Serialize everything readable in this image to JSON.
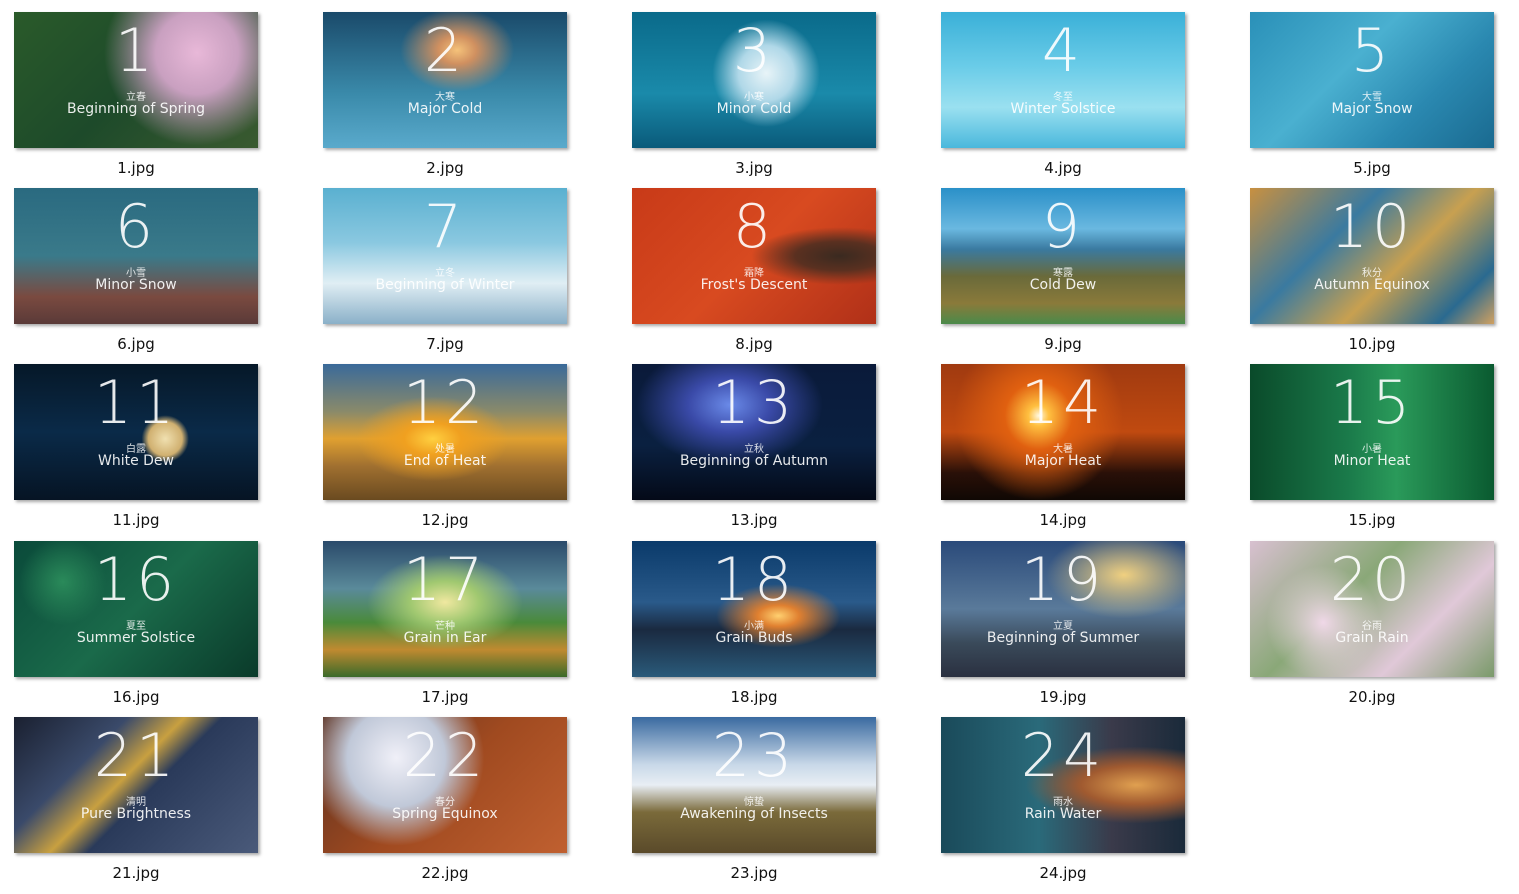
{
  "files": [
    {
      "name": "1.jpg",
      "num": "1",
      "cn": "立春",
      "en": "Beginning of Spring",
      "bg": "radial-gradient(circle at 75% 30%,#e8b8d8 0,#c9a0c0 20%,transparent 45%),linear-gradient(135deg,#2a5a2a,#1d4a2a 50%,#3a5a30)"
    },
    {
      "name": "2.jpg",
      "num": "2",
      "cn": "大寒",
      "en": "Major Cold",
      "bg": "radial-gradient(ellipse at 55% 28%,#f5c27a 0,#d09060 10%,transparent 30%),linear-gradient(180deg,#1a4a6a,#2a6a8a 30%,#3a8aaa 60%,#5aaacc)"
    },
    {
      "name": "3.jpg",
      "num": "3",
      "cn": "小寒",
      "en": "Minor Cold",
      "bg": "radial-gradient(circle at 55% 45%,#e8f4f8 0,#b0d8e8 18%,transparent 35%),linear-gradient(180deg,#0a6a8a,#1a8aaa 60%,#0a5a7a)"
    },
    {
      "name": "4.jpg",
      "num": "4",
      "cn": "冬至",
      "en": "Winter Solstice",
      "bg": "linear-gradient(180deg,#3ab0d8,#6acce8 40%,#9ae0f0 70%,#4ab8dc)"
    },
    {
      "name": "5.jpg",
      "num": "5",
      "cn": "大雪",
      "en": "Major Snow",
      "bg": "linear-gradient(135deg,#2a90b8,#4ab0d0 40%,#2a88b0 70%,#1a6a90)"
    },
    {
      "name": "6.jpg",
      "num": "6",
      "cn": "小雪",
      "en": "Minor Snow",
      "bg": "linear-gradient(180deg,#2a6a80,#3a7a8a 50%,#7a4a40 80%,#5a3a38)"
    },
    {
      "name": "7.jpg",
      "num": "7",
      "cn": "立冬",
      "en": "Beginning of Winter",
      "bg": "linear-gradient(180deg,#5ab0d0,#8ac8e0 40%,#e0eef4 70%,#8ab0c8)"
    },
    {
      "name": "8.jpg",
      "num": "8",
      "cn": "霜降",
      "en": "Frost's Descent",
      "bg": "radial-gradient(ellipse at 85% 50%,#3a2a20 0,#5a3020 15%,transparent 30%),linear-gradient(135deg,#c83a18,#d84a20 50%,#b03018)"
    },
    {
      "name": "9.jpg",
      "num": "9",
      "cn": "寒露",
      "en": "Cold Dew",
      "bg": "linear-gradient(180deg,#2a90c8,#6ab8e0 30%,#3a7aa0 45%,#6a6a3a 65%,#8a7a3a 85%,#4a8a4a)"
    },
    {
      "name": "10.jpg",
      "num": "10",
      "cn": "秋分",
      "en": "Autumn Equinox",
      "bg": "linear-gradient(135deg,#c89040,#3a7aa0 35%,#c8a050 60%,#2a6a90 85%,#d0a060)"
    },
    {
      "name": "11.jpg",
      "num": "11",
      "cn": "白露",
      "en": "White Dew",
      "bg": "radial-gradient(circle at 62% 55%,#f0e0b0 0,#d0b070 10%,transparent 14%),linear-gradient(180deg,#061828,#0a2a48 50%,#061424)"
    },
    {
      "name": "12.jpg",
      "num": "12",
      "cn": "处暑",
      "en": "End of Heat",
      "bg": "radial-gradient(ellipse at 45% 55%,#ffd040 0,#f0a020 15%,transparent 40%),linear-gradient(180deg,#3a6a9a,#8a8a6a 35%,#e0a030 55%,#a07030 75%,#6a4a20)"
    },
    {
      "name": "13.jpg",
      "num": "13",
      "cn": "立秋",
      "en": "Beginning of Autumn",
      "bg": "radial-gradient(ellipse at 40% 30%,#6a8ae8 0,#3a4aa8 20%,transparent 45%),linear-gradient(180deg,#0a1a3a,#0a2040 60%,#040a18)"
    },
    {
      "name": "14.jpg",
      "num": "14",
      "cn": "大暑",
      "en": "Major Heat",
      "bg": "radial-gradient(circle at 40% 38%,#fff8e0 0,#ffc040 6%,#e06010 20%,transparent 50%),linear-gradient(180deg,#a03a10,#c04a10 50%,#2a1008 80%,#100804)"
    },
    {
      "name": "15.jpg",
      "num": "15",
      "cn": "小暑",
      "en": "Minor Heat",
      "bg": "linear-gradient(90deg,#0a4a2a,#1a7a4a 40%,#2a9a5a 60%,#0a5a30)"
    },
    {
      "name": "16.jpg",
      "num": "16",
      "cn": "夏至",
      "en": "Summer Solstice",
      "bg": "radial-gradient(circle at 20% 30%,#2a8a5a 0,transparent 20%),linear-gradient(135deg,#0a4a3a,#1a6a4a 50%,#0a3a2a)"
    },
    {
      "name": "17.jpg",
      "num": "17",
      "cn": "芒种",
      "en": "Grain in Ear",
      "bg": "radial-gradient(ellipse at 50% 45%,#f0e8a0 0,#a0c870 20%,transparent 45%),linear-gradient(180deg,#2a4a6a,#5a8a9a 35%,#4a8a3a 60%,#c08a30 80%,#3a6a2a)"
    },
    {
      "name": "18.jpg",
      "num": "18",
      "cn": "小满",
      "en": "Grain Buds",
      "bg": "radial-gradient(ellipse at 60% 55%,#ffd070 0,#e08030 10%,transparent 30%),linear-gradient(180deg,#0a3a6a,#2a5a8a 45%,#1a2a40 65%,#2a5a7a)"
    },
    {
      "name": "19.jpg",
      "num": "19",
      "cn": "立夏",
      "en": "Beginning of Summer",
      "bg": "radial-gradient(ellipse at 75% 25%,#f0d080 0,transparent 30%),linear-gradient(180deg,#2a4a7a,#5a7a9a 50%,#3a4a5a 75%,#2a3040)"
    },
    {
      "name": "20.jpg",
      "num": "20",
      "cn": "谷雨",
      "en": "Grain Rain",
      "bg": "radial-gradient(circle at 30% 60%,#f0d8e8 0,transparent 30%),linear-gradient(135deg,#d8c0d0,#8aa878 40%,#e0c8d8 70%,#7a9a6a)"
    },
    {
      "name": "21.jpg",
      "num": "21",
      "cn": "清明",
      "en": "Pure Brightness",
      "bg": "linear-gradient(135deg,#1a2030,#3a4a6a 30%,#c8a040 45%,#2a3a5a 55%,#4a5a7a)"
    },
    {
      "name": "22.jpg",
      "num": "22",
      "cn": "春分",
      "en": "Spring Equinox",
      "bg": "radial-gradient(circle at 30% 30%,#f0f0f8 0,#c0c8d8 25%,transparent 45%),linear-gradient(135deg,#5a3020,#a04a20 50%,#c06030)"
    },
    {
      "name": "23.jpg",
      "num": "23",
      "cn": "惊蛰",
      "en": "Awakening of Insects",
      "bg": "linear-gradient(180deg,#3a6aa0,#c8d8e8 35%,#e8eef4 50%,#7a6a3a 70%,#5a4a2a)"
    },
    {
      "name": "24.jpg",
      "num": "24",
      "cn": "雨水",
      "en": "Rain Water",
      "bg": "radial-gradient(ellipse at 80% 50%,#e0a050 0,#a05a30 20%,transparent 40%),linear-gradient(90deg,#1a4a5a,#2a6a7a 40%,#3a3a4a 70%,#1a2a3a)"
    }
  ]
}
